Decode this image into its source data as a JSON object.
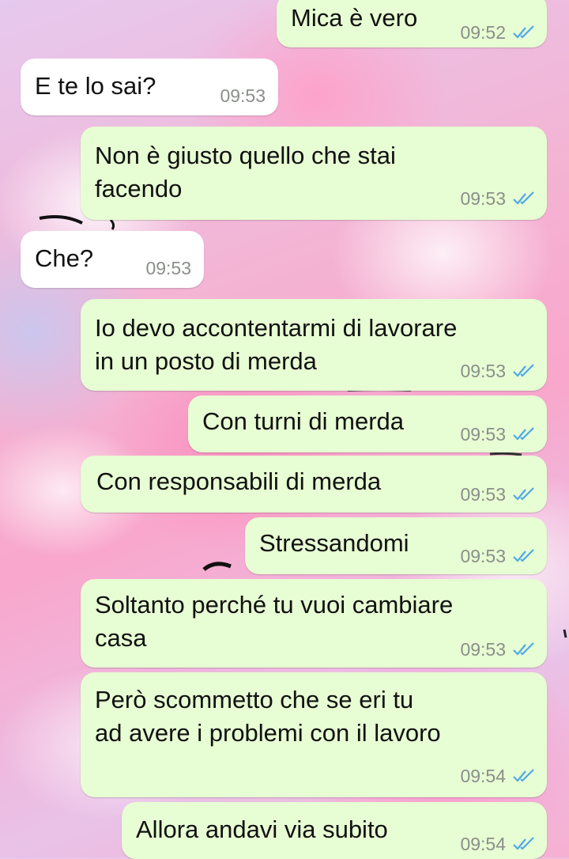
{
  "chat": {
    "messages": [
      {
        "direction": "outgoing",
        "text": "Mica è vero",
        "time": "09:52",
        "status": "read"
      },
      {
        "direction": "incoming",
        "text": "E te lo sai?",
        "time": "09:53"
      },
      {
        "direction": "outgoing",
        "lines": [
          "Non è giusto quello che stai",
          "facendo"
        ],
        "time": "09:53",
        "status": "read"
      },
      {
        "direction": "incoming",
        "text": "Che?",
        "time": "09:53"
      },
      {
        "direction": "outgoing",
        "lines": [
          "Io devo accontentarmi di lavorare",
          "in un posto di merda"
        ],
        "time": "09:53",
        "status": "read"
      },
      {
        "direction": "outgoing",
        "text": "Con turni di merda",
        "time": "09:53",
        "status": "read"
      },
      {
        "direction": "outgoing",
        "text": "Con responsabili di merda",
        "time": "09:53",
        "status": "read"
      },
      {
        "direction": "outgoing",
        "text": "Stressandomi",
        "time": "09:53",
        "status": "read"
      },
      {
        "direction": "outgoing",
        "lines": [
          "Soltanto perché tu vuoi cambiare",
          "casa"
        ],
        "time": "09:53",
        "status": "read"
      },
      {
        "direction": "outgoing",
        "lines": [
          "Però scommetto che se eri tu",
          "ad avere i problemi con il lavoro"
        ],
        "time": "09:54",
        "status": "read"
      },
      {
        "direction": "outgoing",
        "text": "Allora andavi via subito",
        "time": "09:54",
        "status": "read"
      }
    ]
  },
  "colors": {
    "outgoing_bubble": "#e7fdd3",
    "incoming_bubble": "#ffffff",
    "read_ticks": "#4fa9e6",
    "timestamp": "#8a8f8a"
  },
  "icons": {
    "read_status": "double-check-icon"
  }
}
